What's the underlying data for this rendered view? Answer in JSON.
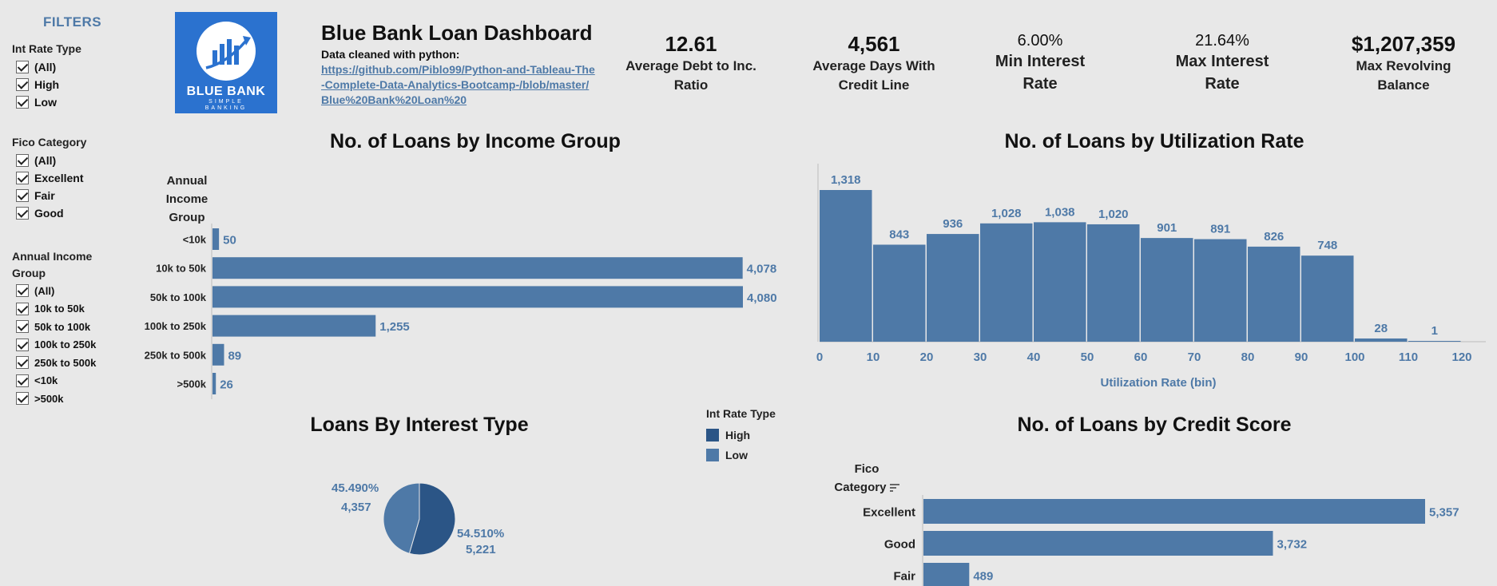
{
  "filters": {
    "title": "FILTERS",
    "int_rate": {
      "title": "Int Rate Type",
      "options": [
        "(All)",
        "High",
        "Low"
      ]
    },
    "fico": {
      "title": "Fico Category",
      "options": [
        "(All)",
        "Excellent",
        "Fair",
        "Good"
      ]
    },
    "income": {
      "title_line1": "Annual Income",
      "title_line2": "Group",
      "options": [
        "(All)",
        "10k to 50k",
        "50k to 100k",
        "100k to 250k",
        "250k to 500k",
        "<10k",
        ">500k"
      ]
    }
  },
  "header": {
    "logo": {
      "name": "BLUE BANK",
      "tagline1": "SIMPLE",
      "tagline2": "BANKING"
    },
    "title": "Blue Bank Loan Dashboard",
    "subtitle": "Data cleaned with python:",
    "link": "https://github.com/Piblo99/Python-and-Tableau-The-Complete-Data-Analytics-Bootcamp-/blob/master/Blue%20Bank%20Loan%20"
  },
  "kpis": [
    {
      "value": "12.61",
      "label1": "Average Debt to Inc.",
      "label2": "Ratio"
    },
    {
      "value": "4,561",
      "label1": "Average Days With",
      "label2": "Credit Line"
    },
    {
      "value": "6.00%",
      "label1": "Min Interest",
      "label2": "Rate"
    },
    {
      "value": "21.64%",
      "label1": "Max Interest",
      "label2": "Rate"
    },
    {
      "value": "$1,207,359",
      "label1": "Max Revolving",
      "label2": "Balance"
    }
  ],
  "income_chart": {
    "title": "No. of Loans by Income Group",
    "header_lines": [
      "Annual",
      "Income",
      "Group"
    ]
  },
  "util_chart": {
    "title": "No. of Loans by Utilization Rate",
    "xlabel": "Utilization Rate (bin)"
  },
  "interest_chart": {
    "title": "Loans By Interest Type",
    "legend_title": "Int Rate Type",
    "legend": [
      {
        "name": "High",
        "color": "#2b5586"
      },
      {
        "name": "Low",
        "color": "#4e79a7"
      }
    ]
  },
  "credit_chart": {
    "title": "No. of Loans by Credit Score",
    "header_lines": [
      "Fico",
      "Category"
    ]
  },
  "chart_data": [
    {
      "type": "bar",
      "orientation": "horizontal",
      "title": "No. of Loans by Income Group",
      "categories": [
        "<10k",
        "10k to 50k",
        "50k to 100k",
        "100k to 250k",
        "250k to 500k",
        ">500k"
      ],
      "values": [
        50,
        4078,
        4080,
        1255,
        89,
        26
      ],
      "labels": [
        "50",
        "4,078",
        "4,080",
        "1,255",
        "89",
        "26"
      ],
      "color": "#4e79a7"
    },
    {
      "type": "bar",
      "title": "No. of Loans by Utilization Rate",
      "xlabel": "Utilization Rate (bin)",
      "bins": [
        0,
        10,
        20,
        30,
        40,
        50,
        60,
        70,
        80,
        90,
        100,
        110
      ],
      "bin_width": 10,
      "values": [
        1318,
        843,
        936,
        1028,
        1038,
        1020,
        901,
        891,
        826,
        748,
        28,
        1
      ],
      "labels": [
        "1,318",
        "843",
        "936",
        "1,028",
        "1,038",
        "1,020",
        "901",
        "891",
        "826",
        "748",
        "28",
        "1"
      ],
      "x_ticks": [
        "0",
        "10",
        "20",
        "30",
        "40",
        "50",
        "60",
        "70",
        "80",
        "90",
        "100",
        "110",
        "120"
      ],
      "xlim": [
        0,
        120
      ],
      "color": "#4e79a7"
    },
    {
      "type": "pie",
      "title": "Loans By Interest Type",
      "slices": [
        {
          "name": "High",
          "value": 5221,
          "pct": "54.510%",
          "label": "5,221",
          "color": "#2b5586"
        },
        {
          "name": "Low",
          "value": 4357,
          "pct": "45.490%",
          "label": "4,357",
          "color": "#4e79a7"
        }
      ]
    },
    {
      "type": "bar",
      "orientation": "horizontal",
      "title": "No. of Loans by Credit Score",
      "categories": [
        "Excellent",
        "Good",
        "Fair"
      ],
      "values": [
        5357,
        3732,
        489
      ],
      "labels": [
        "5,357",
        "3,732",
        "489"
      ],
      "color": "#4e79a7"
    }
  ]
}
